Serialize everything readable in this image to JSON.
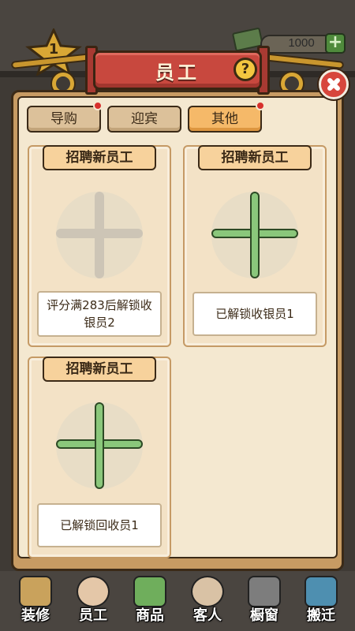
{
  "hud": {
    "level": "1",
    "coins": "1000",
    "add_label": "+"
  },
  "dialog": {
    "title": "员工",
    "help_label": "?",
    "close_icon": "close-icon"
  },
  "tabs": [
    {
      "label": "导购",
      "active": false,
      "has_notice": true
    },
    {
      "label": "迎宾",
      "active": false,
      "has_notice": false
    },
    {
      "label": "其他",
      "active": true,
      "has_notice": true
    }
  ],
  "cards": [
    {
      "header": "招聘新员工",
      "status": "评分满283后解锁收银员2",
      "unlocked": false
    },
    {
      "header": "招聘新员工",
      "status": "已解锁收银员1",
      "unlocked": true
    },
    {
      "header": "招聘新员工",
      "status": "已解锁回收员1",
      "unlocked": true
    }
  ],
  "bottom_nav": [
    {
      "label": "装修",
      "icon": "furniture-icon"
    },
    {
      "label": "员工",
      "icon": "staff-icon"
    },
    {
      "label": "商品",
      "icon": "goods-icon"
    },
    {
      "label": "客人",
      "icon": "customer-icon"
    },
    {
      "label": "橱窗",
      "icon": "showcase-icon"
    },
    {
      "label": "搬迁",
      "icon": "relocate-icon"
    }
  ],
  "colors": {
    "accent_red": "#c8483e",
    "panel": "#c79b63",
    "plus_unlocked": "#8ac77b",
    "plus_locked": "#cdc5b6",
    "tab_active": "#f5b969"
  }
}
